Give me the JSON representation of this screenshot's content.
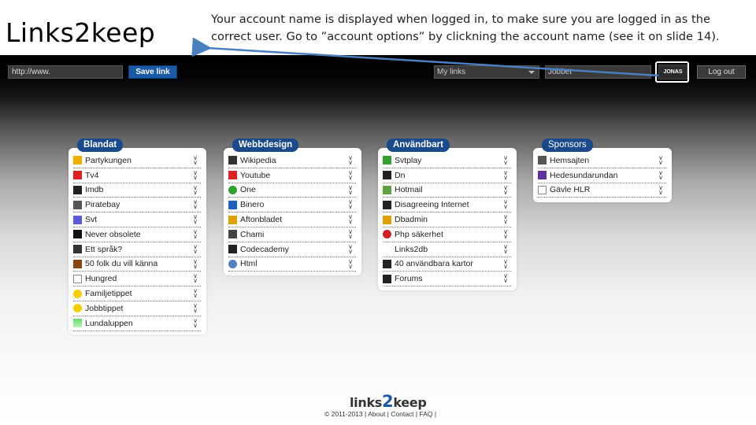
{
  "slide": {
    "title": "Links2keep",
    "note": "Your account name is displayed when logged in, to make sure you are logged in as the correct user. Go to ”account options” by clickning the account name (see it on slide 14)."
  },
  "toolbar": {
    "url_value": "http://www.",
    "save_label": "Save link",
    "mylinks_label": "My links",
    "jobbet_label": "Jobbet",
    "account_name": "JONAS",
    "logout_label": "Log out"
  },
  "panels": [
    {
      "title": "Blandat",
      "items": [
        {
          "label": "Partykungen",
          "icon": "crown-icon",
          "color": "#f0b000"
        },
        {
          "label": "Tv4",
          "icon": "tv4-icon",
          "color": "#e02020"
        },
        {
          "label": "Imdb",
          "icon": "imdb-icon",
          "color": "#222222"
        },
        {
          "label": "Piratebay",
          "icon": "ship-icon",
          "color": "#555555"
        },
        {
          "label": "Svt",
          "icon": "flower-icon",
          "color": "#5a5adc"
        },
        {
          "label": "Never obsolete",
          "icon": "info-icon",
          "color": "#111111"
        },
        {
          "label": "Ett språk?",
          "icon": "wiki-icon",
          "color": "#333333"
        },
        {
          "label": "50 folk du vill känna",
          "icon": "square-icon",
          "color": "#8b4513"
        },
        {
          "label": "Hungred",
          "icon": "blank-page-icon",
          "color": "#ffffff"
        },
        {
          "label": "Familjetippet",
          "icon": "smiley-icon",
          "color": "#f5d000"
        },
        {
          "label": "Jobbtippet",
          "icon": "smiley-icon",
          "color": "#f5d000"
        },
        {
          "label": "Lundaluppen",
          "icon": "gradient-square-icon",
          "color": "#40c040"
        }
      ]
    },
    {
      "title": "Webbdesign",
      "items": [
        {
          "label": "Wikipedia",
          "icon": "wiki-icon",
          "color": "#333333"
        },
        {
          "label": "Youtube",
          "icon": "youtube-icon",
          "color": "#e02020"
        },
        {
          "label": "One",
          "icon": "one-icon",
          "color": "#30a030"
        },
        {
          "label": "Binero",
          "icon": "binero-icon",
          "color": "#2060c0"
        },
        {
          "label": "Aftonbladet",
          "icon": "aftonbladet-icon",
          "color": "#e0a000"
        },
        {
          "label": "Chami",
          "icon": "chami-icon",
          "color": "#444444"
        },
        {
          "label": "Codecademy",
          "icon": "codecademy-icon",
          "color": "#222222"
        },
        {
          "label": "Html",
          "icon": "globe-icon",
          "color": "#5080c0"
        }
      ]
    },
    {
      "title": "Användbart",
      "items": [
        {
          "label": "Svtplay",
          "icon": "play-icon",
          "color": "#30a030"
        },
        {
          "label": "Dn",
          "icon": "dn-icon",
          "color": "#222222"
        },
        {
          "label": "Hotmail",
          "icon": "mail-icon",
          "color": "#60a040"
        },
        {
          "label": "Disagreeing Internet",
          "icon": "speaker-icon",
          "color": "#222222"
        },
        {
          "label": "Dbadmin",
          "icon": "pma-icon",
          "color": "#e0a000"
        },
        {
          "label": "Php säkerhet",
          "icon": "red-ball-icon",
          "color": "#d02020"
        },
        {
          "label": "Links2db",
          "icon": "none",
          "color": "#ffffff"
        },
        {
          "label": "40 användbara kartor",
          "icon": "person-icon",
          "color": "#222222"
        },
        {
          "label": "Forums",
          "icon": "check-icon",
          "color": "#222222"
        }
      ]
    },
    {
      "title": "Sponsors",
      "items": [
        {
          "label": "Hemsajten",
          "icon": "x-icon",
          "color": "#555555"
        },
        {
          "label": "Hedesundarundan",
          "icon": "pen-icon",
          "color": "#6030a0"
        },
        {
          "label": "Gävle HLR",
          "icon": "blank-page-icon",
          "color": "#ffffff"
        }
      ]
    }
  ],
  "footer": {
    "logo_part1": "links",
    "logo_part2": "2",
    "logo_part3": "keep",
    "copyright": "© 2011-2013 | About | Contact | FAQ |"
  }
}
